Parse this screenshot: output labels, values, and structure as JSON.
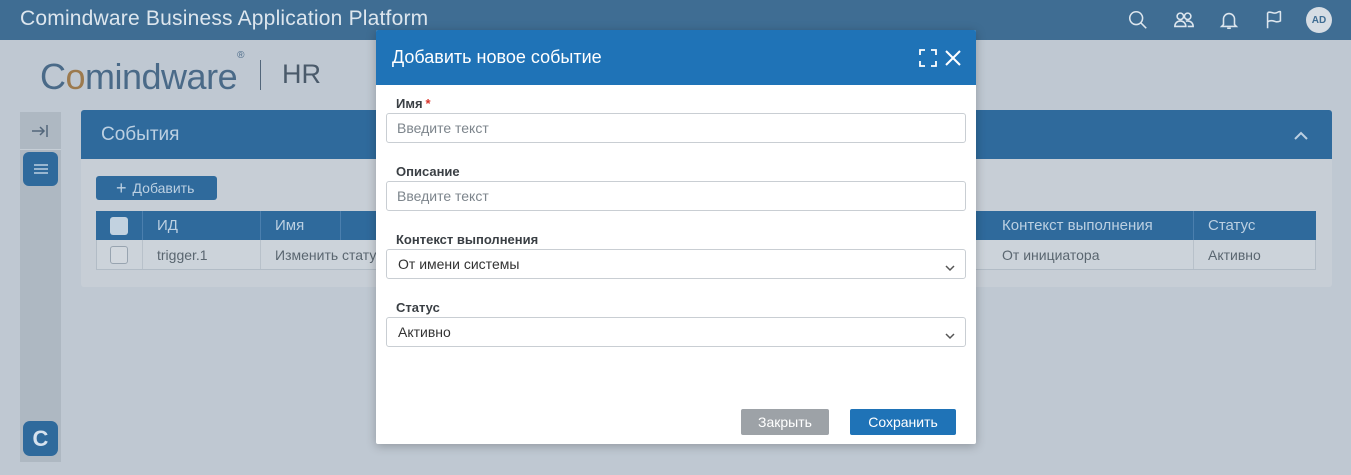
{
  "app": {
    "title": "Comindware Business Application Platform"
  },
  "topbar": {
    "icons": [
      "search-icon",
      "users-icon",
      "bell-icon",
      "flag-icon"
    ],
    "avatar_initials": "AD"
  },
  "brand": {
    "logo_text_a": "C",
    "logo_text_o": "o",
    "logo_text_b": "mindware",
    "logo_reg": "®",
    "app_name": "HR"
  },
  "panel": {
    "title": "События",
    "add_button_label": "Добавить",
    "columns": [
      "ИД",
      "Имя",
      "Контекст выполнения",
      "Статус"
    ],
    "rows": [
      {
        "id": "trigger.1",
        "name": "Изменить стату",
        "context": "От инициатора",
        "status": "Активно"
      }
    ]
  },
  "rail": {
    "bottom_badge": "C"
  },
  "modal": {
    "title": "Добавить новое событие",
    "fields": {
      "name": {
        "label": "Имя",
        "required_mark": "*",
        "placeholder": "Введите текст",
        "value": ""
      },
      "description": {
        "label": "Описание",
        "placeholder": "Введите текст",
        "value": ""
      },
      "context": {
        "label": "Контекст выполнения",
        "value": "От имени системы"
      },
      "status": {
        "label": "Статус",
        "value": "Активно"
      }
    },
    "buttons": {
      "close": "Закрыть",
      "save": "Сохранить"
    }
  },
  "colors": {
    "topbar": "#3f6d93",
    "primary": "#1f73b7",
    "required": "#d9342b",
    "button_secondary": "#9da2a7"
  }
}
